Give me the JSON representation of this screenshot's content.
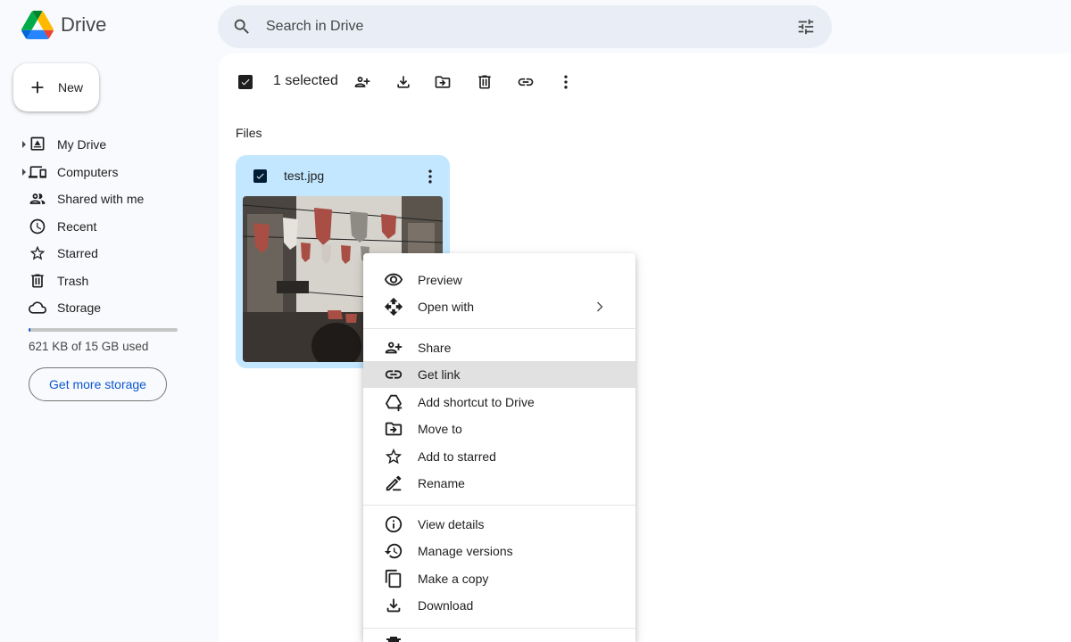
{
  "app": {
    "name": "Drive"
  },
  "search": {
    "placeholder": "Search in Drive"
  },
  "sidebar": {
    "new_label": "New",
    "items": [
      {
        "label": "My Drive",
        "icon": "my-drive-icon"
      },
      {
        "label": "Computers",
        "icon": "computers-icon"
      },
      {
        "label": "Shared with me",
        "icon": "shared-icon"
      },
      {
        "label": "Recent",
        "icon": "clock-icon"
      },
      {
        "label": "Starred",
        "icon": "star-icon"
      },
      {
        "label": "Trash",
        "icon": "trash-icon"
      },
      {
        "label": "Storage",
        "icon": "cloud-icon"
      }
    ],
    "storage_used_fraction": 0.01,
    "storage_text": "621 KB of 15 GB used",
    "get_storage_label": "Get more storage"
  },
  "toolbar": {
    "selected_text": "1 selected"
  },
  "main": {
    "section_title": "Files",
    "file": {
      "name": "test.jpg"
    }
  },
  "context_menu": {
    "items": [
      {
        "label": "Preview",
        "icon": "eye-icon"
      },
      {
        "label": "Open with",
        "icon": "move-arrows-icon",
        "submenu": true
      },
      {
        "label": "Share",
        "icon": "person-add-icon"
      },
      {
        "label": "Get link",
        "icon": "link-icon",
        "highlighted": true
      },
      {
        "label": "Add shortcut to Drive",
        "icon": "drive-shortcut-icon"
      },
      {
        "label": "Move to",
        "icon": "folder-move-icon"
      },
      {
        "label": "Add to starred",
        "icon": "star-icon"
      },
      {
        "label": "Rename",
        "icon": "pencil-icon"
      },
      {
        "label": "View details",
        "icon": "info-icon"
      },
      {
        "label": "Manage versions",
        "icon": "history-icon"
      },
      {
        "label": "Make a copy",
        "icon": "copy-icon"
      },
      {
        "label": "Download",
        "icon": "download-icon"
      }
    ]
  },
  "colors": {
    "accent": "#0b57d0",
    "selected_card": "#c2e7ff",
    "search_bg": "#e9eef6",
    "menu_highlight": "#e1e1e1"
  }
}
